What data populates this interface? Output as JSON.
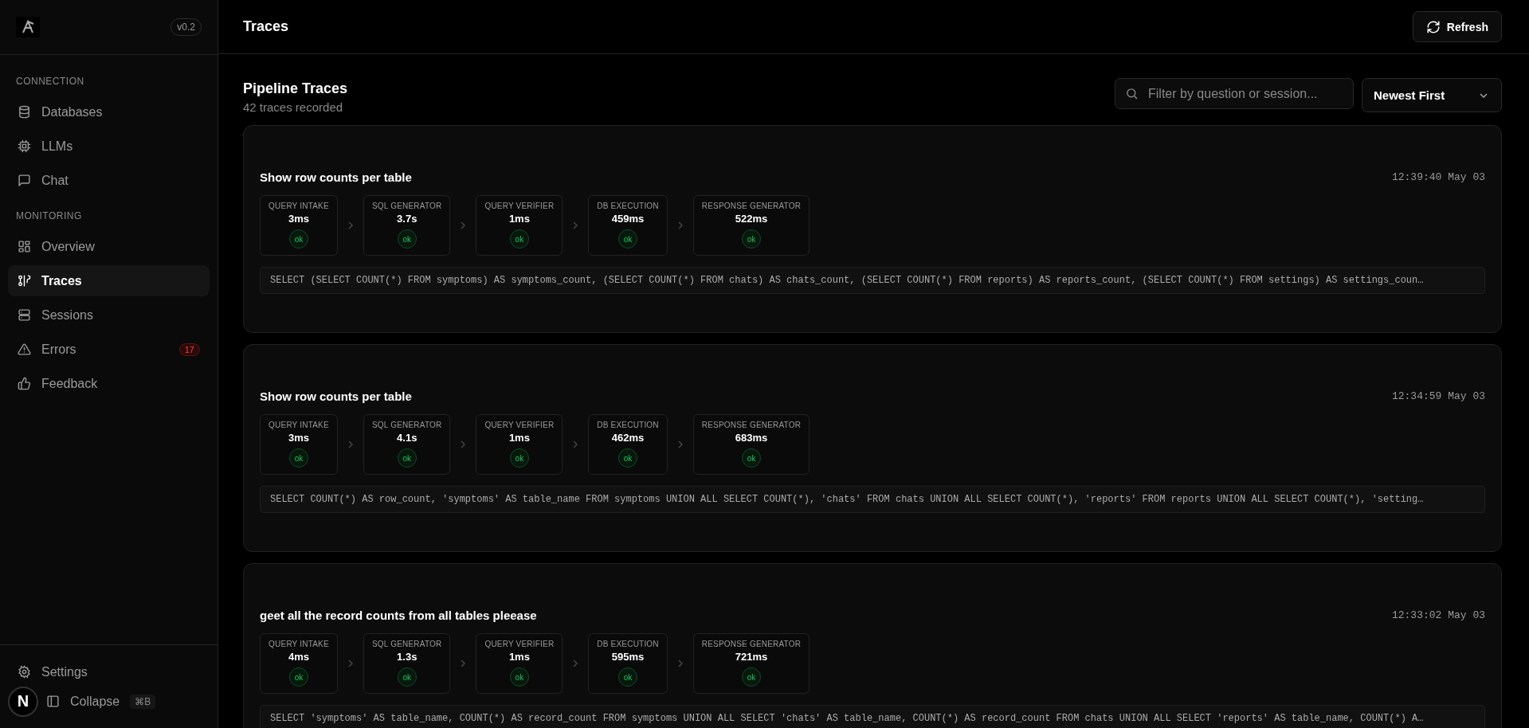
{
  "sidebar": {
    "version": "v0.2",
    "sections": [
      {
        "heading": "CONNECTION",
        "items": [
          {
            "label": "Databases",
            "selected": false
          },
          {
            "label": "LLMs",
            "selected": false
          },
          {
            "label": "Chat",
            "selected": false
          }
        ]
      },
      {
        "heading": "MONITORING",
        "items": [
          {
            "label": "Overview",
            "selected": false
          },
          {
            "label": "Traces",
            "selected": true
          },
          {
            "label": "Sessions",
            "selected": false
          },
          {
            "label": "Errors",
            "selected": false,
            "badge": "17"
          },
          {
            "label": "Feedback",
            "selected": false
          }
        ]
      }
    ],
    "footer": {
      "settings": "Settings",
      "collapse": "Collapse",
      "shortcut": "⌘B"
    }
  },
  "dev_badge": "N",
  "header": {
    "title": "Traces",
    "refresh": "Refresh"
  },
  "page": {
    "title": "Pipeline Traces",
    "subtitle": "42 traces recorded",
    "filter": {
      "placeholder": "Filter by question or session..."
    },
    "sort": {
      "value": "Newest First"
    }
  },
  "traces": [
    {
      "question": "Show row counts per table",
      "time": "12:39:40 May 03",
      "stages": [
        {
          "name": "QUERY INTAKE",
          "duration": "3ms",
          "status": "ok"
        },
        {
          "name": "SQL GENERATOR",
          "duration": "3.7s",
          "status": "ok"
        },
        {
          "name": "QUERY VERIFIER",
          "duration": "1ms",
          "status": "ok"
        },
        {
          "name": "DB EXECUTION",
          "duration": "459ms",
          "status": "ok"
        },
        {
          "name": "RESPONSE GENERATOR",
          "duration": "522ms",
          "status": "ok"
        }
      ],
      "sql": "SELECT (SELECT COUNT(*) FROM symptoms) AS symptoms_count, (SELECT COUNT(*) FROM chats) AS chats_count, (SELECT COUNT(*) FROM reports) AS reports_count, (SELECT COUNT(*) FROM settings) AS settings_coun…"
    },
    {
      "question": "Show row counts per table",
      "time": "12:34:59 May 03",
      "stages": [
        {
          "name": "QUERY INTAKE",
          "duration": "3ms",
          "status": "ok"
        },
        {
          "name": "SQL GENERATOR",
          "duration": "4.1s",
          "status": "ok"
        },
        {
          "name": "QUERY VERIFIER",
          "duration": "1ms",
          "status": "ok"
        },
        {
          "name": "DB EXECUTION",
          "duration": "462ms",
          "status": "ok"
        },
        {
          "name": "RESPONSE GENERATOR",
          "duration": "683ms",
          "status": "ok"
        }
      ],
      "sql": "SELECT COUNT(*) AS row_count, 'symptoms' AS table_name FROM symptoms UNION ALL SELECT COUNT(*), 'chats' FROM chats UNION ALL SELECT COUNT(*), 'reports' FROM reports UNION ALL SELECT COUNT(*), 'setting…"
    },
    {
      "question": "geet all the record counts from all tables pleease",
      "time": "12:33:02 May 03",
      "stages": [
        {
          "name": "QUERY INTAKE",
          "duration": "4ms",
          "status": "ok"
        },
        {
          "name": "SQL GENERATOR",
          "duration": "1.3s",
          "status": "ok"
        },
        {
          "name": "QUERY VERIFIER",
          "duration": "1ms",
          "status": "ok"
        },
        {
          "name": "DB EXECUTION",
          "duration": "595ms",
          "status": "ok"
        },
        {
          "name": "RESPONSE GENERATOR",
          "duration": "721ms",
          "status": "ok"
        }
      ],
      "sql": "SELECT 'symptoms' AS table_name, COUNT(*) AS record_count FROM symptoms UNION ALL SELECT 'chats' AS table_name, COUNT(*) AS record_count FROM chats UNION ALL SELECT 'reports' AS table_name, COUNT(*) A…"
    }
  ]
}
